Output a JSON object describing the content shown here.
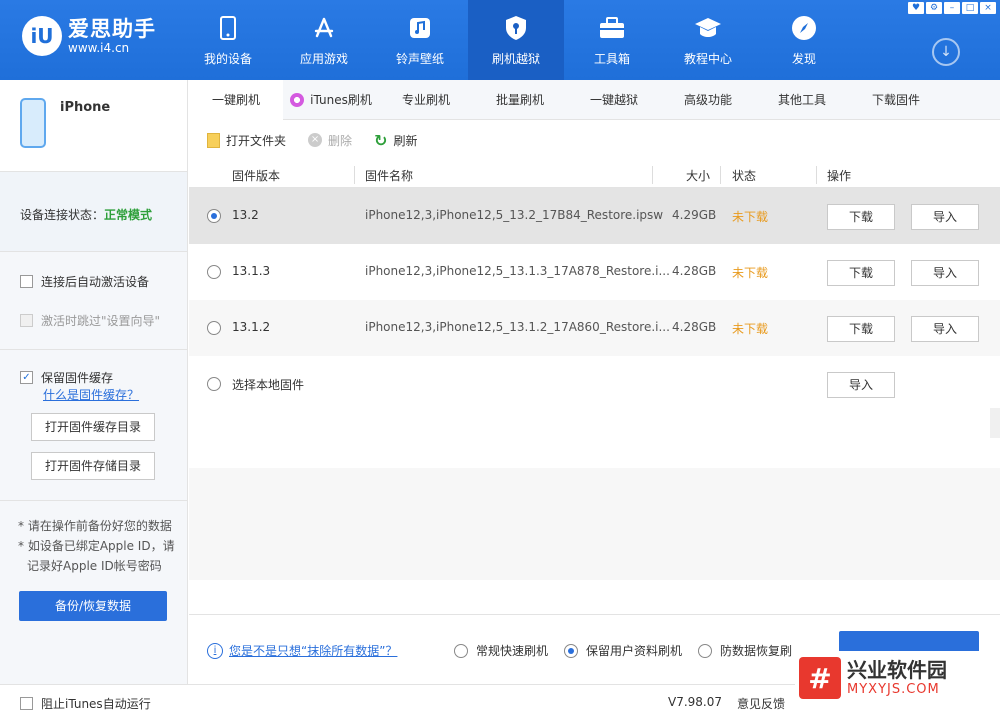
{
  "app": {
    "name": "爱思助手",
    "url": "www.i4.cn",
    "logo_glyph": "iU"
  },
  "nav": [
    {
      "label": "我的设备",
      "icon": "phone-icon"
    },
    {
      "label": "应用游戏",
      "icon": "appstore-icon"
    },
    {
      "label": "铃声壁纸",
      "icon": "music-icon"
    },
    {
      "label": "刷机越狱",
      "icon": "shield-key-icon",
      "active": true
    },
    {
      "label": "工具箱",
      "icon": "toolbox-icon"
    },
    {
      "label": "教程中心",
      "icon": "graduation-cap-icon"
    },
    {
      "label": "发现",
      "icon": "compass-icon"
    }
  ],
  "device": {
    "name": "iPhone"
  },
  "sidebar": {
    "conn_label": "设备连接状态：",
    "conn_value": "正常模式",
    "auto_activate": "连接后自动激活设备",
    "skip_setup": "激活时跳过\"设置向导\"",
    "keep_cache": "保留固件缓存",
    "what_cache": "什么是固件缓存？",
    "open_cache_dir": "打开固件缓存目录",
    "open_store_dir": "打开固件存储目录",
    "note1": "* 请在操作前备份好您的数据",
    "note2": "* 如设备已绑定Apple ID，请",
    "note3": "记录好Apple ID帐号密码",
    "backup_btn": "备份/恢复数据"
  },
  "tabs": [
    "一键刷机",
    "iTunes刷机",
    "专业刷机",
    "批量刷机",
    "一键越狱",
    "高级功能",
    "其他工具",
    "下载固件"
  ],
  "toolbar": {
    "open_folder": "打开文件夹",
    "delete": "删除",
    "refresh": "刷新"
  },
  "table": {
    "headers": {
      "version": "固件版本",
      "name": "固件名称",
      "size": "大小",
      "status": "状态",
      "action": "操作"
    },
    "rows": [
      {
        "version": "13.2",
        "name": "iPhone12,3,iPhone12,5_13.2_17B84_Restore.ipsw",
        "size": "4.29GB",
        "status": "未下载",
        "download": "下载",
        "import": "导入",
        "selected": true
      },
      {
        "version": "13.1.3",
        "name": "iPhone12,3,iPhone12,5_13.1.3_17A878_Restore.i...",
        "size": "4.28GB",
        "status": "未下载",
        "download": "下载",
        "import": "导入"
      },
      {
        "version": "13.1.2",
        "name": "iPhone12,3,iPhone12,5_13.1.2_17A860_Restore.i...",
        "size": "4.28GB",
        "status": "未下载",
        "download": "下载",
        "import": "导入"
      }
    ],
    "local": {
      "label": "选择本地固件",
      "import": "导入"
    }
  },
  "bottom": {
    "info_link": "您是不是只想“抹除所有数据”？",
    "opt1": "常规快速刷机",
    "opt2": "保留用户资料刷机",
    "opt3": "防数据恢复刷"
  },
  "statusbar": {
    "itunes": "阻止iTunes自动运行",
    "version": "V7.98.07",
    "feedback": "意见反馈"
  },
  "watermark": {
    "mark": "#",
    "title": "兴业软件园",
    "url": "MYXYJS.COM"
  },
  "colors": {
    "brand": "#1f6fd9",
    "status_warn": "#e89a1d",
    "ok": "#2e9f3a"
  }
}
